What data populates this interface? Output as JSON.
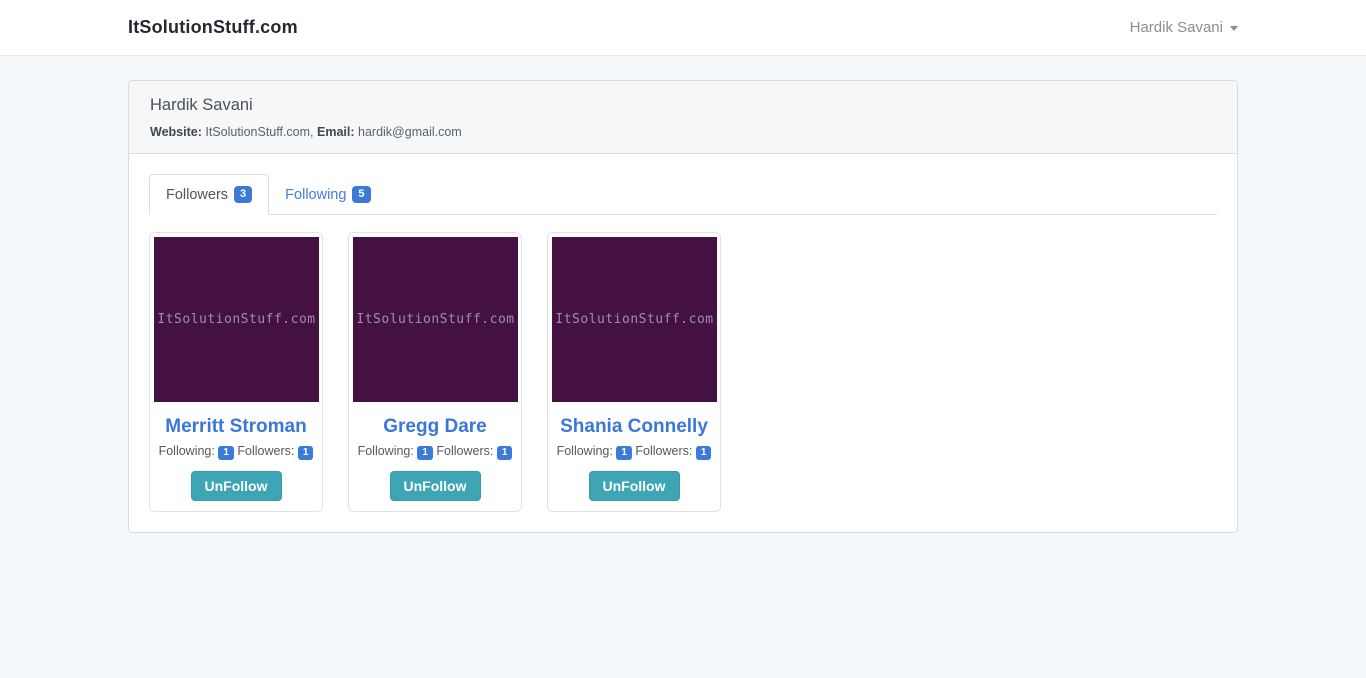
{
  "navbar": {
    "brand": "ItSolutionStuff.com",
    "user_menu": "Hardik Savani"
  },
  "profile": {
    "name": "Hardik Savani",
    "website_label": "Website:",
    "website_value": "ItSolutionStuff.com,",
    "email_label": "Email:",
    "email_value": "hardik@gmail.com"
  },
  "tabs": [
    {
      "label": "Followers",
      "count": "3",
      "active": true
    },
    {
      "label": "Following",
      "count": "5",
      "active": false
    }
  ],
  "cards": [
    {
      "image_text": "ItSolutionStuff.com",
      "name": "Merritt Stroman",
      "following_label": "Following:",
      "following_count": "1",
      "followers_label": "Followers:",
      "followers_count": "1",
      "button_label": "UnFollow"
    },
    {
      "image_text": "ItSolutionStuff.com",
      "name": "Gregg Dare",
      "following_label": "Following:",
      "following_count": "1",
      "followers_label": "Followers:",
      "followers_count": "1",
      "button_label": "UnFollow"
    },
    {
      "image_text": "ItSolutionStuff.com",
      "name": "Shania Connelly",
      "following_label": "Following:",
      "following_count": "1",
      "followers_label": "Followers:",
      "followers_count": "1",
      "button_label": "UnFollow"
    }
  ],
  "colors": {
    "body_background": "#f5f8fa",
    "navbar_background": "#ffffff",
    "badge_blue": "#3b7ad8",
    "name_link_blue": "#3b76d9",
    "tab_link_blue": "#447fd8",
    "unfollow_teal": "#3da5b4",
    "avatar_purple": "#451143",
    "panel_heading_gray": "#f6f7f8"
  }
}
